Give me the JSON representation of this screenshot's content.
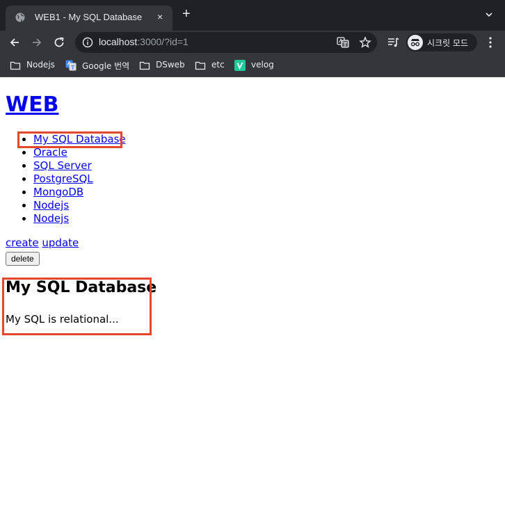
{
  "browser": {
    "tab_title": "WEB1 - My SQL Database",
    "tab_close": "×",
    "new_tab": "+",
    "url_host": "localhost",
    "url_rest": ":3000/?id=1",
    "incognito_label": "시크릿 모드",
    "bookmarks": [
      {
        "label": "Nodejs",
        "icon": "folder-icon"
      },
      {
        "label": "Google 번역",
        "icon": "google-translate-icon"
      },
      {
        "label": "DSweb",
        "icon": "folder-icon"
      },
      {
        "label": "etc",
        "icon": "folder-icon"
      },
      {
        "label": "velog",
        "icon": "velog-icon"
      }
    ]
  },
  "page": {
    "site_title": "WEB",
    "topics": [
      "My SQL Database",
      "Oracle",
      "SQL Server",
      "PostgreSQL",
      "MongoDB",
      "Nodejs",
      "Nodejs"
    ],
    "create_label": "create",
    "update_label": "update",
    "delete_label": "delete",
    "article_title": "My SQL Database",
    "article_body": "My SQL is relational..."
  },
  "colors": {
    "highlight_box": "#e5462c",
    "link": "#0000ee",
    "chrome_dark": "#202124",
    "chrome_toolbar": "#35363a"
  }
}
